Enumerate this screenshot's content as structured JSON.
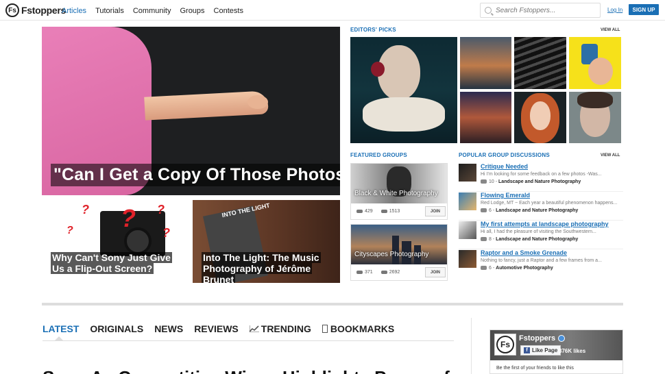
{
  "header": {
    "logo_text": "Fstoppers",
    "logo_badge": "Fs",
    "nav": [
      "Articles",
      "Tutorials",
      "Community",
      "Groups",
      "Contests"
    ],
    "search_placeholder": "Search Fstoppers...",
    "login": "Log In",
    "signup": "SIGN UP"
  },
  "hero": {
    "title": "\"Can I Get a Copy Of Those Photos?\""
  },
  "stories": [
    {
      "title": "Why Can't Sony Just Give Us a Flip-Out Screen?"
    },
    {
      "title": "Into The Light: The Music Photography of Jérôme Brunet",
      "book_label": "INTO THE LIGHT"
    }
  ],
  "editors_picks": {
    "label": "EDITORS' PICKS",
    "view_all": "VIEW ALL"
  },
  "featured_groups": {
    "label": "FEATURED GROUPS",
    "groups": [
      {
        "name": "Black & White Photography",
        "comments": "429",
        "members": "1513",
        "join": "JOIN"
      },
      {
        "name": "Cityscapes Photography",
        "comments": "371",
        "members": "2692",
        "join": "JOIN"
      }
    ]
  },
  "discussions": {
    "label": "POPULAR GROUP DISCUSSIONS",
    "view_all": "VIEW ALL",
    "items": [
      {
        "title": "Critique Needed",
        "snippet": "Hi I'm looking for some feedback on a few photos -Was...",
        "count": "10",
        "group": "Landscape and Nature Photography"
      },
      {
        "title": "Flowing Emerald",
        "snippet": "Red Lodge, MT ~ Each year a beautiful phenomenon happens...",
        "count": "6",
        "group": "Landscape and Nature Photography"
      },
      {
        "title": "My first attempts at landscape photography",
        "snippet": "Hi all, I had the pleasure of visiting the Southwestern...",
        "count": "8",
        "group": "Landscape and Nature Photography"
      },
      {
        "title": "Raptor and a Smoke Grenade",
        "snippet": "Nothing to fancy, just a Raptor and a few frames from a...",
        "count": "6",
        "group": "Automotive Photography"
      }
    ]
  },
  "tabs": [
    "LATEST",
    "ORIGINALS",
    "NEWS",
    "REVIEWS",
    "TRENDING",
    "BOOKMARKS"
  ],
  "facebook": {
    "name": "Fstoppers",
    "like": "Like Page",
    "likes": "376K likes",
    "note": "Be the first of your friends to like this"
  },
  "bottom_headline": "Sony A...Competitive Wins...Highlights Power of"
}
